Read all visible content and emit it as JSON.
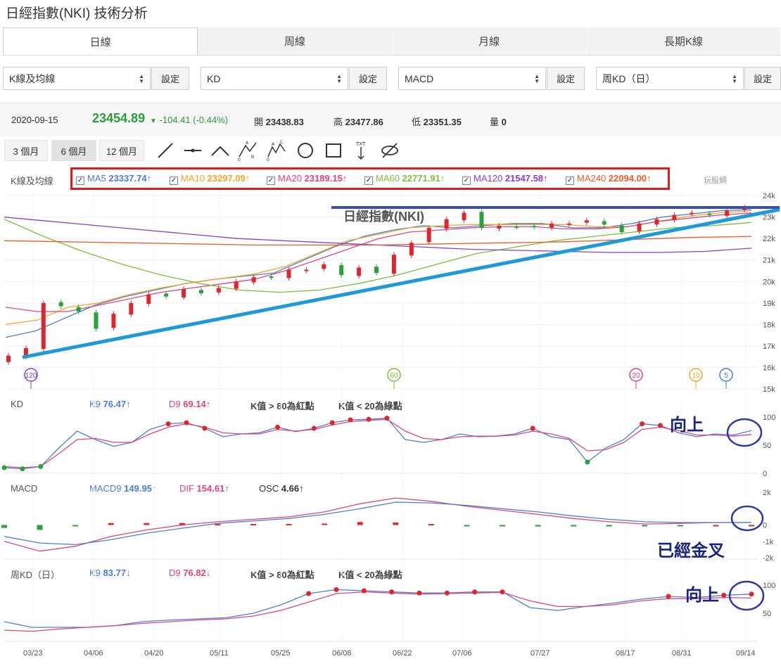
{
  "page": {
    "title": "日經指數(NKI) 技術分析"
  },
  "tabs": [
    {
      "label": "日線",
      "active": true
    },
    {
      "label": "周線"
    },
    {
      "label": "月線"
    },
    {
      "label": "長期K線"
    }
  ],
  "selectors": [
    {
      "value": "K線及均線",
      "button": "設定"
    },
    {
      "value": "KD",
      "button": "設定"
    },
    {
      "value": "MACD",
      "button": "設定"
    },
    {
      "value": "周KD（日）",
      "button": "設定"
    }
  ],
  "quote": {
    "date": "2020-09-15",
    "price": "23454.89",
    "change": "-104.41 (-0.44%)",
    "open_label": "開",
    "open": "23438.83",
    "high_label": "高",
    "high": "23477.86",
    "low_label": "低",
    "low": "23351.35",
    "vol_label": "量",
    "vol": "0"
  },
  "ranges": [
    "3 個月",
    "6 個月",
    "12 個月"
  ],
  "active_range": "6 個月",
  "tools": [
    "line-tool-icon",
    "horizontal-line-icon",
    "angle-icon",
    "abc-pattern-icon",
    "abcd-pattern-icon",
    "circle-tool-icon",
    "rectangle-tool-icon",
    "text-tool-icon",
    "eye-hidden-icon"
  ],
  "watermark": "玩股網",
  "colors": {
    "up": "#e0262d",
    "down": "#2aa23b",
    "ma5": "#4a7fd6",
    "ma10": "#f5a623",
    "ma20": "#e0457b",
    "ma60": "#7cbf3a",
    "ma120": "#8a3fd1",
    "ma240": "#f05a28",
    "annotation": "#1a237e",
    "trend": "#1e9ad6"
  },
  "ma_panel": {
    "label": "K線及均線",
    "items": [
      {
        "name": "MA5",
        "value": "23337.74↑",
        "color": "#4a7fd6"
      },
      {
        "name": "MA10",
        "value": "23297.09↑",
        "color": "#f5a623"
      },
      {
        "name": "MA20",
        "value": "23189.15↑",
        "color": "#e0457b"
      },
      {
        "name": "MA60",
        "value": "22771.91↑",
        "color": "#7cbf3a"
      },
      {
        "name": "MA120",
        "value": "21547.58↑",
        "color": "#8a3fd1"
      },
      {
        "name": "MA240",
        "value": "22094.00↑",
        "color": "#f05a28"
      }
    ],
    "check": "✓"
  },
  "kd_panel": {
    "label": "KD",
    "k_name": "K9",
    "k_value": "76.47↑",
    "d_name": "D9",
    "d_value": "69.14↑",
    "note1": "K值 > 80為紅點",
    "note2": "K值 < 20為綠點"
  },
  "macd_panel": {
    "label": "MACD",
    "macd_name": "MACD9",
    "macd_value": "149.95↑",
    "dif_name": "DIF",
    "dif_value": "154.61↑",
    "osc_name": "OSC",
    "osc_value": "4.66↑"
  },
  "wkd_panel": {
    "label": "周KD（日）",
    "k_name": "K9",
    "k_value": "83.77↓",
    "d_name": "D9",
    "d_value": "76.82↓",
    "note1": "K值 > 80為紅點",
    "note2": "K值 < 20為綠點"
  },
  "annotations": {
    "kd": "向上",
    "macd": "已經金叉",
    "wkd": "向上",
    "chart_name": "日經指數(NKI)"
  },
  "ma_markers": [
    "120",
    "60",
    "20",
    "10",
    "5"
  ],
  "chart_data": [
    {
      "type": "candlestick",
      "title": "日經指數(NKI)",
      "yticks": [
        "24k",
        "23k",
        "22k",
        "21k",
        "20k",
        "19k",
        "18k",
        "17k",
        "16k",
        "15k"
      ],
      "ylim": [
        15000,
        24200
      ],
      "xticks": [
        "03/23",
        "04/06",
        "04/20",
        "05/11",
        "05/25",
        "06/08",
        "06/22",
        "07/06",
        "07/27",
        "08/17",
        "08/31",
        "09/14"
      ],
      "close_approx": [
        16550,
        16900,
        19000,
        18850,
        18600,
        17800,
        18500,
        19000,
        19400,
        19300,
        19650,
        19450,
        19700,
        20000,
        20200,
        20200,
        20550,
        20550,
        20800,
        20300,
        20650,
        20400,
        21250,
        21800,
        22500,
        22900,
        23200,
        22500,
        22600,
        22550,
        22550,
        22700,
        22700,
        22850,
        22650,
        22300,
        22700,
        22900,
        23100,
        23200,
        23100,
        23300,
        23450
      ],
      "series": [
        {
          "name": "MA5",
          "values": [
            17400,
            17700,
            18300,
            18900,
            19300,
            19600,
            19900,
            20100,
            20250,
            20400,
            21000,
            21600,
            22100,
            22400,
            22600,
            22500,
            22600,
            22700,
            22700,
            22500,
            22500,
            22700,
            23000,
            23150,
            23300,
            23350
          ]
        },
        {
          "name": "MA10",
          "values": [
            18000,
            18200,
            18800,
            19000,
            19400,
            19700,
            19950,
            20150,
            20350,
            20700,
            21300,
            21900,
            22200,
            22500,
            22600,
            22650,
            22650,
            22650,
            22650,
            22550,
            22550,
            22800,
            23050,
            23200,
            23300
          ]
        },
        {
          "name": "MA20",
          "values": [
            18800,
            18600,
            18600,
            18900,
            19200,
            19500,
            19700,
            19900,
            20100,
            20500,
            21000,
            21500,
            22000,
            22300,
            22400,
            22500,
            22550,
            22550,
            22450,
            22450,
            22550,
            22800,
            22950,
            23100,
            23190
          ]
        },
        {
          "name": "MA60",
          "values": [
            22900,
            22100,
            21400,
            20800,
            20300,
            19900,
            19600,
            19500,
            19600,
            19900,
            20300,
            20800,
            21300,
            21600,
            21900,
            22100,
            22300,
            22500,
            22600,
            22750
          ]
        },
        {
          "name": "MA120",
          "values": [
            23000,
            22800,
            22600,
            22400,
            22200,
            22000,
            21900,
            21800,
            21700,
            21600,
            21500,
            21450,
            21400,
            21350,
            21350,
            21400,
            21550
          ]
        },
        {
          "name": "MA240",
          "values": [
            21900,
            21850,
            21800,
            21750,
            21700,
            21700,
            21700,
            21750,
            21800,
            21850,
            21950,
            22050,
            22100
          ]
        }
      ]
    },
    {
      "type": "line",
      "name": "KD",
      "yticks": [
        "100",
        "50",
        "0"
      ],
      "ylim": [
        0,
        100
      ],
      "series": [
        {
          "name": "K9",
          "values": [
            10,
            8,
            12,
            45,
            75,
            60,
            48,
            55,
            78,
            88,
            90,
            80,
            65,
            70,
            72,
            82,
            74,
            80,
            90,
            95,
            96,
            98,
            60,
            55,
            60,
            70,
            65,
            66,
            70,
            80,
            65,
            60,
            20,
            45,
            60,
            88,
            85,
            72,
            65,
            70,
            68,
            76
          ]
        },
        {
          "name": "D9",
          "values": [
            12,
            10,
            12,
            35,
            60,
            62,
            55,
            55,
            70,
            82,
            88,
            82,
            72,
            70,
            70,
            78,
            75,
            78,
            86,
            92,
            94,
            96,
            75,
            62,
            60,
            65,
            66,
            66,
            68,
            75,
            70,
            62,
            40,
            42,
            55,
            78,
            82,
            76,
            68,
            68,
            66,
            69
          ]
        }
      ]
    },
    {
      "type": "line",
      "name": "MACD",
      "yticks": [
        "2k",
        "0",
        "-1k",
        "-2k"
      ],
      "ylim": [
        -2000,
        2000
      ],
      "series": [
        {
          "name": "DIF",
          "values": [
            -1000,
            -1600,
            -1300,
            -700,
            -300,
            0,
            200,
            350,
            500,
            800,
            1300,
            1650,
            1450,
            1150,
            900,
            650,
            400,
            200,
            60,
            100,
            150,
            155
          ]
        },
        {
          "name": "MACD9",
          "values": [
            -700,
            -1100,
            -1200,
            -900,
            -500,
            -200,
            100,
            250,
            400,
            650,
            1000,
            1400,
            1350,
            1200,
            1000,
            800,
            550,
            350,
            200,
            150,
            150,
            150
          ]
        }
      ]
    },
    {
      "type": "line",
      "name": "周KD（日）",
      "yticks": [
        "100",
        "50"
      ],
      "ylim": [
        0,
        100
      ],
      "series": [
        {
          "name": "K9",
          "values": [
            35,
            25,
            25,
            25,
            28,
            35,
            38,
            40,
            42,
            50,
            65,
            85,
            92,
            90,
            88,
            86,
            86,
            88,
            88,
            60,
            55,
            62,
            68,
            75,
            80,
            78,
            82,
            84
          ]
        },
        {
          "name": "D9",
          "values": [
            20,
            18,
            22,
            25,
            28,
            32,
            35,
            38,
            40,
            45,
            55,
            70,
            85,
            88,
            86,
            84,
            85,
            86,
            87,
            72,
            62,
            62,
            65,
            72,
            76,
            76,
            78,
            77
          ]
        }
      ]
    }
  ]
}
